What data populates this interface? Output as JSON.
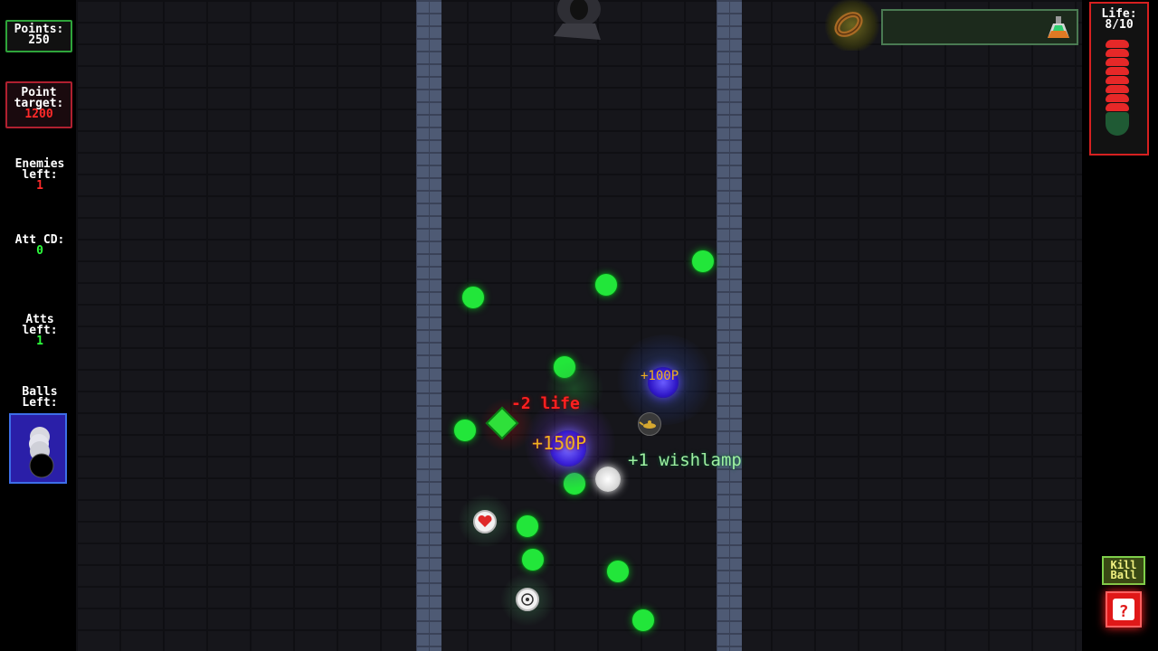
{
  "hud_left": {
    "points_label": "Points:",
    "points_value": "250",
    "target_label_line1": "Point",
    "target_label_line2": "target:",
    "target_value": "1200",
    "enemies_label_line1": "Enemies",
    "enemies_label_line2": "left:",
    "enemies_value": "1",
    "att_cd_label": "Att CD:",
    "att_cd_value": "0",
    "atts_label_line1": "Atts",
    "atts_label_line2": "left:",
    "atts_value": "1",
    "balls_label_line1": "Balls",
    "balls_label_line2": "Left:"
  },
  "hud_right": {
    "life_label": "Life:",
    "life_value": "8/10",
    "life_current": 8,
    "life_max": 10,
    "kill_ball_line1": "Kill",
    "kill_ball_line2": "Ball",
    "help_icon": "question-icon"
  },
  "inventory": {
    "items": [
      "bracelet-icon",
      "potion-icon"
    ]
  },
  "floating_text": {
    "life_loss": "-2 life",
    "points_gain_1": "+150P",
    "points_gain_2": "+100P",
    "item_gain": "+1 wishlamp"
  },
  "colors": {
    "accent_green": "#22e63a",
    "life_red": "#e62828",
    "points_orange": "#f0b020",
    "item_text_green": "#9df0a0"
  }
}
